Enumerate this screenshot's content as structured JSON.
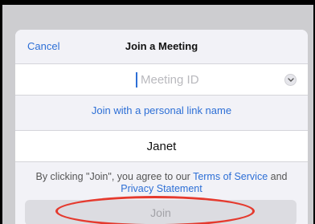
{
  "dialog": {
    "cancel_label": "Cancel",
    "title": "Join a Meeting"
  },
  "meeting_id": {
    "value": "",
    "placeholder": "Meeting ID"
  },
  "personal_link_label": "Join with a personal link name",
  "name_field": {
    "value": "Janet"
  },
  "terms": {
    "prefix": "By clicking \"Join\", you agree to our ",
    "terms_link": "Terms of Service",
    "conjunction": " and",
    "privacy_link": "Privacy Statement"
  },
  "join_label": "Join",
  "colors": {
    "accent": "#2d6fd6",
    "annotation": "#e53a2e"
  },
  "icons": {
    "dropdown": "chevron-down-icon"
  }
}
